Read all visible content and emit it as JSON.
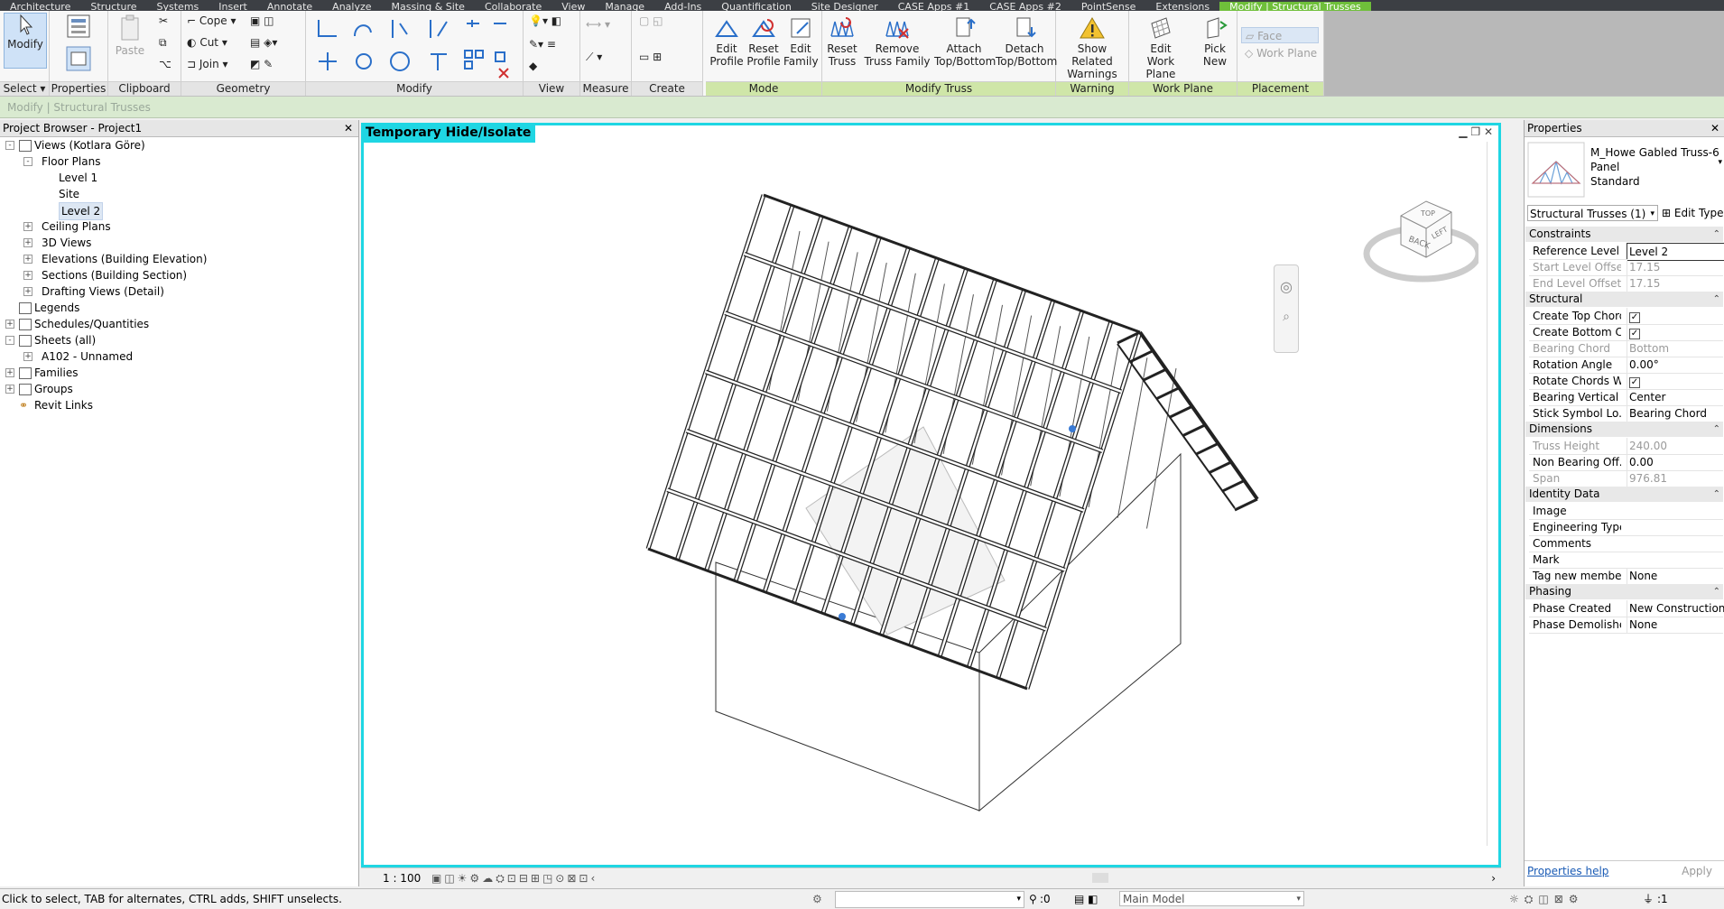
{
  "tabs": [
    "Architecture",
    "Structure",
    "Systems",
    "Insert",
    "Annotate",
    "Analyze",
    "Massing & Site",
    "Collaborate",
    "View",
    "Manage",
    "Add-Ins",
    "Quantification",
    "Site Designer",
    "CASE Apps #1",
    "CASE Apps #2",
    "PointSense",
    "Extensions",
    "Modify | Structural Trusses"
  ],
  "ribbon": {
    "select": {
      "modify": "Modify",
      "select": "Select"
    },
    "properties": {
      "label": "Properties"
    },
    "clipboard": {
      "paste": "Paste",
      "label": "Clipboard"
    },
    "geometry": {
      "cope": "Cope",
      "cut": "Cut",
      "join": "Join",
      "label": "Geometry"
    },
    "modify_label": "Modify",
    "view_label": "View",
    "measure_label": "Measure",
    "create_label": "Create",
    "mode": {
      "edit_profile": [
        "Edit",
        "Profile"
      ],
      "reset_profile": [
        "Reset",
        "Profile"
      ],
      "edit_family": [
        "Edit",
        "Family"
      ],
      "label": "Mode"
    },
    "modify_truss": {
      "reset_truss": [
        "Reset",
        "Truss"
      ],
      "remove_truss_family": [
        "Remove",
        "Truss Family"
      ],
      "attach": [
        "Attach",
        "Top/Bottom"
      ],
      "detach": [
        "Detach",
        "Top/Bottom"
      ],
      "label": "Modify Truss"
    },
    "warning": {
      "show_related": [
        "Show Related",
        "Warnings"
      ],
      "label": "Warning"
    },
    "work_plane": {
      "edit_work_plane": [
        "Edit",
        "Work Plane"
      ],
      "pick_new": [
        "Pick",
        "New"
      ],
      "label": "Work Plane"
    },
    "placement": {
      "face": "Face",
      "work_plane": "Work Plane",
      "label": "Placement"
    }
  },
  "options_bar": "Modify | Structural Trusses",
  "project_browser": {
    "title": "Project Browser - Project1",
    "items": [
      {
        "label": "Views (Kotlara Göre)",
        "level": 0,
        "exp": "-",
        "icon": "views"
      },
      {
        "label": "Floor Plans",
        "level": 1,
        "exp": "-"
      },
      {
        "label": "Level 1",
        "level": 2
      },
      {
        "label": "Site",
        "level": 2
      },
      {
        "label": "Level 2",
        "level": 2,
        "selected": true
      },
      {
        "label": "Ceiling Plans",
        "level": 1,
        "exp": "+"
      },
      {
        "label": "3D Views",
        "level": 1,
        "exp": "+"
      },
      {
        "label": "Elevations (Building Elevation)",
        "level": 1,
        "exp": "+"
      },
      {
        "label": "Sections (Building Section)",
        "level": 1,
        "exp": "+"
      },
      {
        "label": "Drafting Views (Detail)",
        "level": 1,
        "exp": "+"
      },
      {
        "label": "Legends",
        "level": 0,
        "icon": "legend"
      },
      {
        "label": "Schedules/Quantities",
        "level": 0,
        "exp": "+",
        "icon": "schedule"
      },
      {
        "label": "Sheets (all)",
        "level": 0,
        "exp": "-",
        "icon": "sheet"
      },
      {
        "label": "A102 - Unnamed",
        "level": 1,
        "exp": "+"
      },
      {
        "label": "Families",
        "level": 0,
        "exp": "+",
        "icon": "family"
      },
      {
        "label": "Groups",
        "level": 0,
        "exp": "+",
        "icon": "group"
      },
      {
        "label": "Revit Links",
        "level": 0,
        "icon": "link"
      }
    ]
  },
  "view": {
    "title": "Temporary Hide/Isolate",
    "scale": "1 : 100",
    "viewcube": {
      "back": "BACK",
      "left": "LEFT",
      "top": "TOP"
    }
  },
  "properties": {
    "title": "Properties",
    "type_name": [
      "M_Howe Gabled Truss-6",
      "Panel",
      "Standard"
    ],
    "selector": "Structural Trusses (1)",
    "edit_type": "Edit Type",
    "sections": [
      {
        "name": "Constraints",
        "rows": [
          [
            "Reference Level",
            "Level 2",
            false
          ],
          [
            "Start Level Offset",
            "17.15",
            true
          ],
          [
            "End Level Offset",
            "17.15",
            true
          ]
        ]
      },
      {
        "name": "Structural",
        "rows": [
          [
            "Create Top Chord",
            "✓",
            false
          ],
          [
            "Create Bottom C...",
            "✓",
            false
          ],
          [
            "Bearing Chord",
            "Bottom",
            true
          ],
          [
            "Rotation Angle",
            "0.00°",
            false
          ],
          [
            "Rotate Chords W...",
            "✓",
            false
          ],
          [
            "Bearing Vertical J...",
            "Center",
            false
          ],
          [
            "Stick Symbol Lo...",
            "Bearing Chord",
            false
          ]
        ]
      },
      {
        "name": "Dimensions",
        "rows": [
          [
            "Truss Height",
            "240.00",
            true
          ],
          [
            "Non Bearing Off...",
            "0.00",
            false
          ],
          [
            "Span",
            "976.81",
            true
          ]
        ]
      },
      {
        "name": "Identity Data",
        "rows": [
          [
            "Image",
            "",
            false
          ],
          [
            "Engineering Type",
            "",
            false
          ],
          [
            "Comments",
            "",
            false
          ],
          [
            "Mark",
            "",
            false
          ],
          [
            "Tag new membe...",
            "None",
            false
          ]
        ]
      },
      {
        "name": "Phasing",
        "rows": [
          [
            "Phase Created",
            "New Construction",
            false
          ],
          [
            "Phase Demolished",
            "None",
            false
          ]
        ]
      }
    ],
    "help": "Properties help",
    "apply": "Apply"
  },
  "status": {
    "message": "Click to select, TAB for alternates, CTRL adds, SHIFT unselects.",
    "zero": ":0",
    "model": "Main Model",
    "filter": ":1"
  },
  "colors": {
    "accent": "#1fd6e3",
    "context_tab": "#6fbf3a"
  }
}
